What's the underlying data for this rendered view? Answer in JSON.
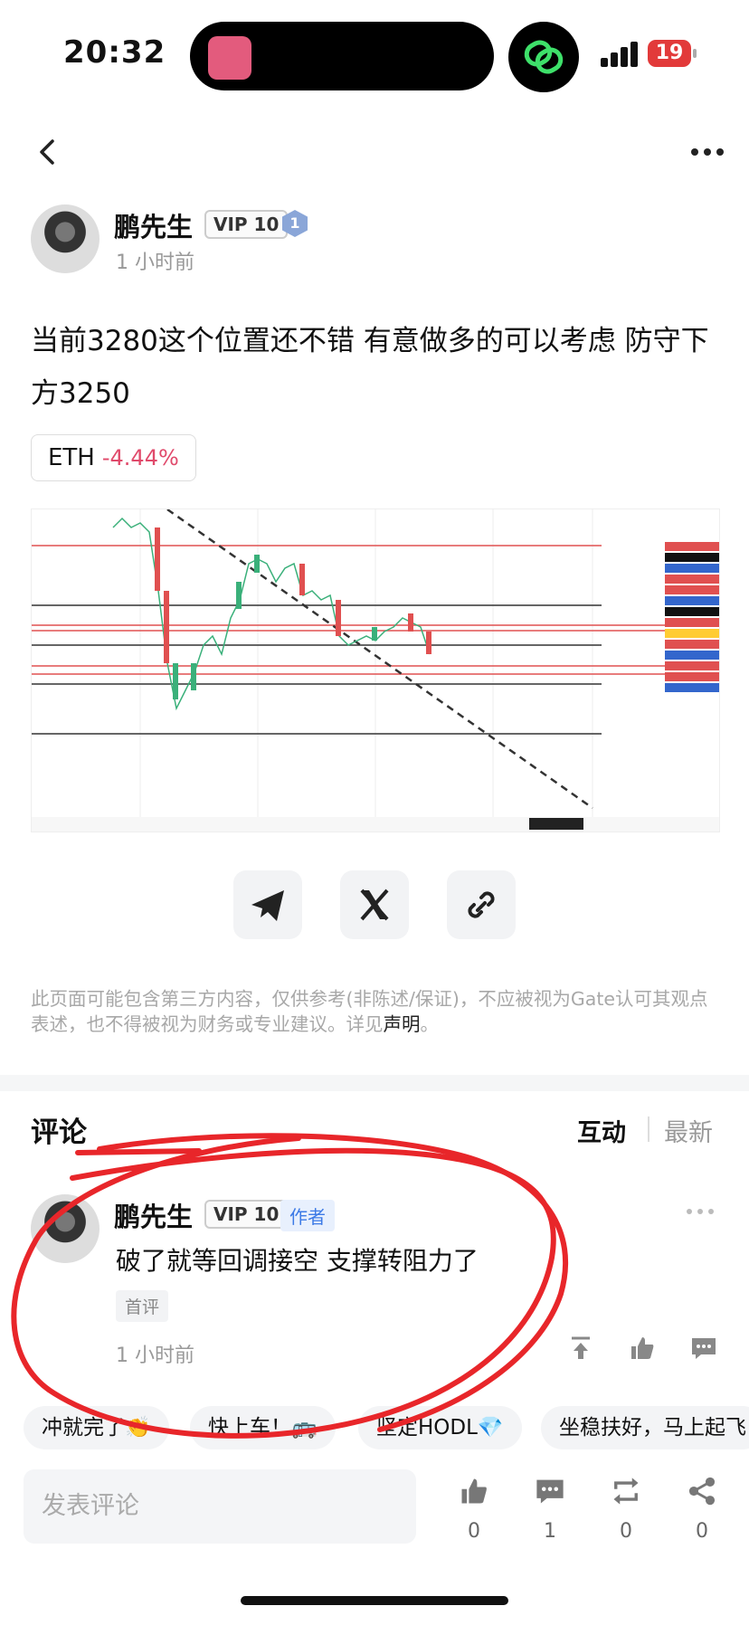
{
  "status_bar": {
    "time": "20:32",
    "battery": "19"
  },
  "post": {
    "author": {
      "name": "鹏先生",
      "vip": "VIP 10",
      "level_badge": "1",
      "time": "1 小时前"
    },
    "text": "当前3280这个位置还不错 有意做多的可以考虑 防守下方3250",
    "token": {
      "symbol": "ETH",
      "change": "-4.44%"
    }
  },
  "disclaimer": {
    "text": "此页面可能包含第三方内容，仅供参考(非陈述/保证)，不应被视为Gate认可其观点表述，也不得被视为财务或专业建议。详见",
    "link": "声明",
    "end": "。"
  },
  "comments": {
    "title": "评论",
    "tabs": [
      "互动",
      "最新"
    ],
    "items": [
      {
        "name": "鹏先生",
        "vip": "VIP 10",
        "tag": "作者",
        "text": "破了就等回调接空 支撑转阻力了",
        "badge": "首评",
        "time": "1 小时前"
      }
    ]
  },
  "chips": [
    "冲就完了👏",
    "快上车！🚌",
    "坚定HODL💎",
    "坐稳扶好，马上起飞"
  ],
  "bottom_bar": {
    "placeholder": "发表评论",
    "like": "0",
    "comment": "1",
    "repost": "0",
    "share": "0"
  },
  "colors": {
    "accent_red": "#e04a6b",
    "author_blue": "#3c7ae6",
    "annotation_red": "#e8262a"
  }
}
